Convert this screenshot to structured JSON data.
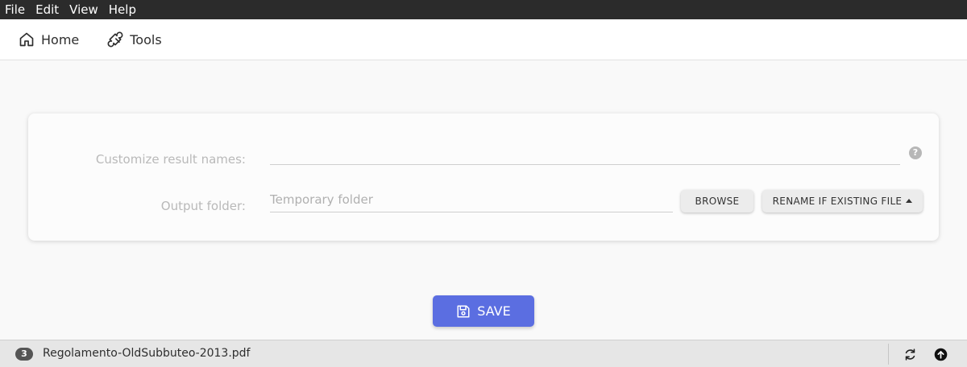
{
  "menubar": {
    "items": [
      "File",
      "Edit",
      "View",
      "Help"
    ]
  },
  "nav": {
    "home_label": "Home",
    "tools_label": "Tools"
  },
  "form": {
    "names_label": "Customize result names:",
    "names_value": "",
    "help_glyph": "?",
    "output_label": "Output folder:",
    "output_placeholder": "Temporary folder",
    "browse_label": "BROWSE",
    "rename_label": "RENAME IF EXISTING FILE"
  },
  "save": {
    "label": "SAVE",
    "color": "#5b6ee1"
  },
  "footer": {
    "badge_count": "3",
    "file_name": "Regolamento-OldSubbuteo-2013.pdf"
  },
  "icons": {
    "home": "home-icon",
    "tools": "wrench-icon",
    "help": "help-icon",
    "save": "floppy-disk-icon",
    "refresh": "refresh-icon",
    "upload": "upload-icon"
  }
}
